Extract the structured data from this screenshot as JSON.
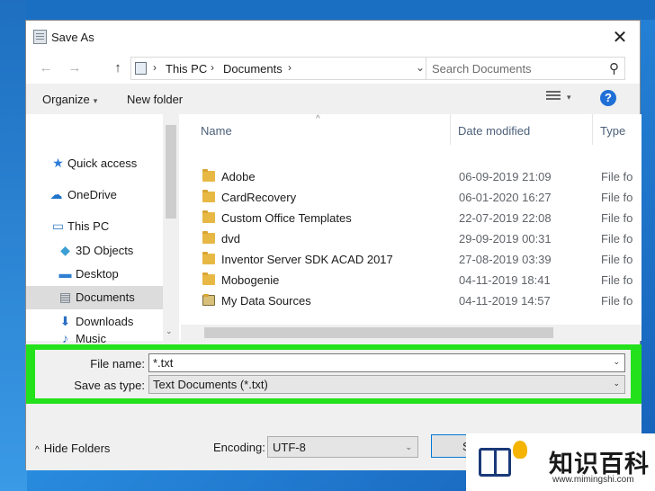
{
  "window": {
    "title": "Save As",
    "close_glyph": "✕"
  },
  "nav": {
    "back_glyph": "←",
    "forward_glyph": "→",
    "up_glyph": "↑",
    "breadcrumb": [
      "This PC",
      "Documents"
    ],
    "separator": "›",
    "dropdown_glyph": "⌄",
    "refresh_glyph": "↻",
    "search_placeholder": "Search Documents",
    "search_glyph": "⚲"
  },
  "toolbar": {
    "organize_label": "Organize",
    "organize_caret": "▾",
    "new_folder_label": "New folder",
    "view_caret": "▾",
    "help_glyph": "?"
  },
  "sidebar": {
    "items": [
      {
        "label": "Quick access",
        "icon": "star-icon",
        "glyph": "★",
        "color": "#2b7bd9",
        "selected": false
      },
      {
        "label": "OneDrive",
        "icon": "cloud-icon",
        "glyph": "☁",
        "color": "#1e73c9",
        "selected": false
      },
      {
        "label": "This PC",
        "icon": "computer-icon",
        "glyph": "▭",
        "color": "#3a7fc4",
        "selected": false
      },
      {
        "label": "3D Objects",
        "icon": "cube-icon",
        "glyph": "◆",
        "color": "#3b9fd3",
        "selected": false
      },
      {
        "label": "Desktop",
        "icon": "desktop-icon",
        "glyph": "▬",
        "color": "#2f7fd2",
        "selected": false
      },
      {
        "label": "Documents",
        "icon": "document-icon",
        "glyph": "▤",
        "color": "#6b7785",
        "selected": true
      },
      {
        "label": "Downloads",
        "icon": "download-icon",
        "glyph": "⬇",
        "color": "#2b6fc2",
        "selected": false
      },
      {
        "label": "Music",
        "icon": "music-icon",
        "glyph": "♪",
        "color": "#2b6fc2",
        "selected": false
      }
    ],
    "scroll_down_glyph": "⌄"
  },
  "filelist": {
    "columns": {
      "name": "Name",
      "date": "Date modified",
      "type": "Type"
    },
    "sort_glyph": "^",
    "rows": [
      {
        "name": "Adobe",
        "date": "06-09-2019 21:09",
        "type": "File fo"
      },
      {
        "name": "CardRecovery",
        "date": "06-01-2020 16:27",
        "type": "File fo"
      },
      {
        "name": "Custom Office Templates",
        "date": "22-07-2019 22:08",
        "type": "File fo"
      },
      {
        "name": "dvd",
        "date": "29-09-2019 00:31",
        "type": "File fo"
      },
      {
        "name": "Inventor Server SDK ACAD 2017",
        "date": "27-08-2019 03:39",
        "type": "File fo"
      },
      {
        "name": "Mobogenie",
        "date": "04-11-2019 18:41",
        "type": "File fo"
      },
      {
        "name": "My Data Sources",
        "date": "04-11-2019 14:57",
        "type": "File fo"
      }
    ]
  },
  "form": {
    "file_name_label": "File name:",
    "file_name_value": "*.txt",
    "save_type_label": "Save as type:",
    "save_type_value": "Text Documents (*.txt)",
    "caret": "⌄"
  },
  "footer": {
    "hide_folders_label": "Hide Folders",
    "hide_folders_glyph": "^",
    "encoding_label": "Encoding:",
    "encoding_value": "UTF-8",
    "encoding_caret": "⌄",
    "save_label": "S"
  },
  "watermark": {
    "text": "知识百科",
    "url": "www.mimingshi.com"
  },
  "colors": {
    "highlight": "#23e11b",
    "accent": "#0078d7"
  }
}
